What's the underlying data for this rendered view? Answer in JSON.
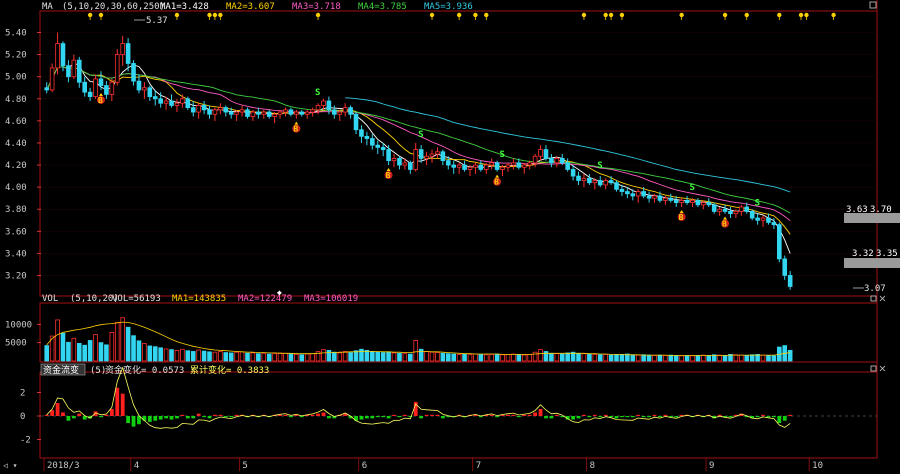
{
  "colors": {
    "bg": "#000000",
    "frame": "#a01010",
    "up": "#ff3030",
    "down": "#33d6f0",
    "ma1": "#ffffff",
    "ma2": "#ffd200",
    "ma3": "#ff5cc6",
    "ma4": "#40d040",
    "ma5": "#30c8e0",
    "tick": "#ff4040",
    "label": "#c8c8c8",
    "pos_bar": "#ff2020",
    "neg_bar": "#10d010",
    "cum_line": "#ffff60",
    "event": "#ffd000",
    "buy": "#ffd000",
    "sell": "#40ff40"
  },
  "main": {
    "legend": {
      "name": "MA",
      "params": "(5,10,20,30,60,250)",
      "ma1": "MA1=3.428",
      "ma2": "MA2=3.607",
      "ma3": "MA3=3.718",
      "ma4": "MA4=3.785",
      "ma5": "MA5=3.936"
    },
    "annotations": {
      "high": "5.37",
      "low": "3.07",
      "right_top_a": "3.63",
      "right_top_b": "3.70",
      "right_bot_a": "3.32",
      "right_bot_b": "3.35"
    },
    "markers": [
      "B",
      "S"
    ]
  },
  "vol": {
    "legend": {
      "name": "VOL",
      "params": "(5,10,20)",
      "vol": "VOL=56193",
      "ma1": "MA1=143835",
      "ma2": "MA2=122479",
      "ma3": "MA3=106019"
    }
  },
  "ind": {
    "legend": {
      "name": "资金流变",
      "params": "(5)",
      "a": "资金变化= 0.0573",
      "b": "累计变化= 0.3833"
    }
  },
  "x_axis": {
    "labels": [
      {
        "text": "2018/3",
        "day": 0
      },
      {
        "text": "4",
        "day": 16
      },
      {
        "text": "5",
        "day": 36
      },
      {
        "text": "6",
        "day": 58
      },
      {
        "text": "7",
        "day": 79
      },
      {
        "text": "8",
        "day": 100
      },
      {
        "text": "9",
        "day": 122
      },
      {
        "text": "10",
        "day": 141
      }
    ]
  },
  "chart_data": {
    "type": "candlestick",
    "y_ticks": [
      "5.40",
      "5.20",
      "5.00",
      "4.80",
      "4.60",
      "4.40",
      "4.20",
      "4.00",
      "3.80",
      "3.60",
      "3.40",
      "3.20"
    ],
    "ylim": [
      3.05,
      5.55
    ],
    "vol_ticks": [
      "10000",
      "5000"
    ],
    "vol_max": 15000,
    "ind_ticks": [
      "2",
      "0",
      "-2"
    ],
    "ind_lim": [
      -3.4,
      3.4
    ],
    "days": 150,
    "candles": [
      [
        4.9,
        4.95,
        4.85,
        4.88
      ],
      [
        4.88,
        5.12,
        4.86,
        5.08
      ],
      [
        5.08,
        5.4,
        5.02,
        5.3
      ],
      [
        5.3,
        5.32,
        5.05,
        5.1
      ],
      [
        5.1,
        5.15,
        4.95,
        5.0
      ],
      [
        5.0,
        5.2,
        4.98,
        5.15
      ],
      [
        5.15,
        5.18,
        4.9,
        4.95
      ],
      [
        4.95,
        5.0,
        4.82,
        4.86
      ],
      [
        4.86,
        4.9,
        4.78,
        4.82
      ],
      [
        4.82,
        5.02,
        4.8,
        4.98
      ],
      [
        4.98,
        5.05,
        4.88,
        4.92
      ],
      [
        4.92,
        4.96,
        4.8,
        4.84
      ],
      [
        4.84,
        4.98,
        4.78,
        4.95
      ],
      [
        4.95,
        5.25,
        4.92,
        5.2
      ],
      [
        5.2,
        5.37,
        5.1,
        5.3
      ],
      [
        5.3,
        5.35,
        5.05,
        5.12
      ],
      [
        5.12,
        5.15,
        4.92,
        4.96
      ],
      [
        4.96,
        5.02,
        4.85,
        4.88
      ],
      [
        4.88,
        4.95,
        4.8,
        4.9
      ],
      [
        4.9,
        4.92,
        4.78,
        4.82
      ],
      [
        4.82,
        4.88,
        4.74,
        4.8
      ],
      [
        4.8,
        4.86,
        4.72,
        4.76
      ],
      [
        4.76,
        4.82,
        4.7,
        4.78
      ],
      [
        4.78,
        4.84,
        4.72,
        4.74
      ],
      [
        4.74,
        4.8,
        4.68,
        4.76
      ],
      [
        4.76,
        4.84,
        4.72,
        4.8
      ],
      [
        4.8,
        4.82,
        4.7,
        4.72
      ],
      [
        4.72,
        4.78,
        4.64,
        4.68
      ],
      [
        4.68,
        4.76,
        4.62,
        4.74
      ],
      [
        4.74,
        4.78,
        4.66,
        4.7
      ],
      [
        4.7,
        4.74,
        4.62,
        4.66
      ],
      [
        4.66,
        4.72,
        4.6,
        4.7
      ],
      [
        4.7,
        4.76,
        4.66,
        4.72
      ],
      [
        4.72,
        4.74,
        4.64,
        4.68
      ],
      [
        4.68,
        4.72,
        4.62,
        4.66
      ],
      [
        4.66,
        4.7,
        4.6,
        4.68
      ],
      [
        4.68,
        4.74,
        4.64,
        4.7
      ],
      [
        4.7,
        4.72,
        4.62,
        4.64
      ],
      [
        4.64,
        4.7,
        4.6,
        4.68
      ],
      [
        4.68,
        4.72,
        4.62,
        4.66
      ],
      [
        4.66,
        4.7,
        4.62,
        4.68
      ],
      [
        4.68,
        4.7,
        4.62,
        4.64
      ],
      [
        4.64,
        4.68,
        4.58,
        4.66
      ],
      [
        4.66,
        4.7,
        4.62,
        4.68
      ],
      [
        4.68,
        4.72,
        4.64,
        4.7
      ],
      [
        4.7,
        4.72,
        4.64,
        4.66
      ],
      [
        4.66,
        4.7,
        4.62,
        4.68
      ],
      [
        4.68,
        4.7,
        4.64,
        4.66
      ],
      [
        4.66,
        4.7,
        4.62,
        4.68
      ],
      [
        4.68,
        4.72,
        4.64,
        4.7
      ],
      [
        4.7,
        4.76,
        4.66,
        4.74
      ],
      [
        4.74,
        4.8,
        4.7,
        4.78
      ],
      [
        4.78,
        4.82,
        4.66,
        4.7
      ],
      [
        4.7,
        4.74,
        4.62,
        4.66
      ],
      [
        4.66,
        4.7,
        4.6,
        4.68
      ],
      [
        4.68,
        4.76,
        4.64,
        4.72
      ],
      [
        4.72,
        4.74,
        4.62,
        4.66
      ],
      [
        4.66,
        4.68,
        4.48,
        4.52
      ],
      [
        4.52,
        4.56,
        4.4,
        4.46
      ],
      [
        4.46,
        4.5,
        4.38,
        4.44
      ],
      [
        4.44,
        4.48,
        4.34,
        4.38
      ],
      [
        4.38,
        4.42,
        4.3,
        4.36
      ],
      [
        4.36,
        4.4,
        4.28,
        4.34
      ],
      [
        4.34,
        4.38,
        4.2,
        4.24
      ],
      [
        4.24,
        4.3,
        4.18,
        4.26
      ],
      [
        4.26,
        4.28,
        4.16,
        4.2
      ],
      [
        4.2,
        4.26,
        4.16,
        4.22
      ],
      [
        4.22,
        4.24,
        4.12,
        4.16
      ],
      [
        4.16,
        4.4,
        4.14,
        4.34
      ],
      [
        4.34,
        4.38,
        4.22,
        4.26
      ],
      [
        4.26,
        4.32,
        4.2,
        4.28
      ],
      [
        4.28,
        4.34,
        4.22,
        4.3
      ],
      [
        4.3,
        4.36,
        4.26,
        4.32
      ],
      [
        4.32,
        4.34,
        4.2,
        4.24
      ],
      [
        4.24,
        4.28,
        4.16,
        4.2
      ],
      [
        4.2,
        4.24,
        4.12,
        4.18
      ],
      [
        4.18,
        4.22,
        4.12,
        4.2
      ],
      [
        4.2,
        4.24,
        4.14,
        4.16
      ],
      [
        4.16,
        4.2,
        4.1,
        4.18
      ],
      [
        4.18,
        4.22,
        4.12,
        4.2
      ],
      [
        4.2,
        4.24,
        4.14,
        4.16
      ],
      [
        4.16,
        4.22,
        4.12,
        4.2
      ],
      [
        4.2,
        4.26,
        4.16,
        4.22
      ],
      [
        4.22,
        4.24,
        4.14,
        4.16
      ],
      [
        4.16,
        4.2,
        4.1,
        4.18
      ],
      [
        4.18,
        4.22,
        4.14,
        4.2
      ],
      [
        4.2,
        4.26,
        4.16,
        4.22
      ],
      [
        4.22,
        4.26,
        4.16,
        4.18
      ],
      [
        4.18,
        4.22,
        4.12,
        4.2
      ],
      [
        4.2,
        4.24,
        4.16,
        4.22
      ],
      [
        4.22,
        4.3,
        4.18,
        4.28
      ],
      [
        4.28,
        4.38,
        4.24,
        4.34
      ],
      [
        4.34,
        4.38,
        4.24,
        4.26
      ],
      [
        4.26,
        4.3,
        4.18,
        4.22
      ],
      [
        4.22,
        4.28,
        4.18,
        4.26
      ],
      [
        4.26,
        4.3,
        4.2,
        4.22
      ],
      [
        4.22,
        4.26,
        4.14,
        4.16
      ],
      [
        4.16,
        4.2,
        4.06,
        4.1
      ],
      [
        4.1,
        4.14,
        4.02,
        4.06
      ],
      [
        4.06,
        4.12,
        4.0,
        4.08
      ],
      [
        4.08,
        4.12,
        4.02,
        4.04
      ],
      [
        4.04,
        4.08,
        3.98,
        4.06
      ],
      [
        4.06,
        4.1,
        4.0,
        4.02
      ],
      [
        4.02,
        4.08,
        3.98,
        4.06
      ],
      [
        4.06,
        4.1,
        4.02,
        4.04
      ],
      [
        4.04,
        4.06,
        3.96,
        3.98
      ],
      [
        3.98,
        4.02,
        3.92,
        3.96
      ],
      [
        3.96,
        4.0,
        3.9,
        3.94
      ],
      [
        3.94,
        3.98,
        3.88,
        3.92
      ],
      [
        3.92,
        3.98,
        3.86,
        3.96
      ],
      [
        3.96,
        4.0,
        3.9,
        3.92
      ],
      [
        3.92,
        3.96,
        3.86,
        3.9
      ],
      [
        3.9,
        3.94,
        3.86,
        3.92
      ],
      [
        3.92,
        3.96,
        3.86,
        3.88
      ],
      [
        3.88,
        3.92,
        3.84,
        3.9
      ],
      [
        3.9,
        3.94,
        3.86,
        3.88
      ],
      [
        3.88,
        3.92,
        3.82,
        3.86
      ],
      [
        3.86,
        3.9,
        3.82,
        3.88
      ],
      [
        3.88,
        3.92,
        3.84,
        3.86
      ],
      [
        3.86,
        3.9,
        3.82,
        3.88
      ],
      [
        3.88,
        3.9,
        3.82,
        3.84
      ],
      [
        3.84,
        3.88,
        3.8,
        3.86
      ],
      [
        3.86,
        3.9,
        3.82,
        3.84
      ],
      [
        3.84,
        3.86,
        3.76,
        3.78
      ],
      [
        3.78,
        3.82,
        3.74,
        3.8
      ],
      [
        3.8,
        3.84,
        3.76,
        3.78
      ],
      [
        3.78,
        3.82,
        3.72,
        3.76
      ],
      [
        3.76,
        3.8,
        3.72,
        3.78
      ],
      [
        3.78,
        3.84,
        3.74,
        3.82
      ],
      [
        3.82,
        3.86,
        3.76,
        3.78
      ],
      [
        3.78,
        3.8,
        3.7,
        3.72
      ],
      [
        3.72,
        3.76,
        3.66,
        3.7
      ],
      [
        3.7,
        3.74,
        3.64,
        3.72
      ],
      [
        3.72,
        3.76,
        3.66,
        3.68
      ],
      [
        3.68,
        3.72,
        3.62,
        3.66
      ],
      [
        3.66,
        3.68,
        3.32,
        3.35
      ],
      [
        3.35,
        3.38,
        3.16,
        3.2
      ],
      [
        3.2,
        3.24,
        3.07,
        3.1
      ]
    ],
    "volumes": [
      4200,
      6800,
      11200,
      7600,
      5100,
      6200,
      4800,
      4300,
      5600,
      7200,
      5000,
      4400,
      7800,
      10500,
      11800,
      9200,
      6900,
      5500,
      4800,
      4100,
      3900,
      3600,
      3300,
      3100,
      2900,
      3200,
      2800,
      2600,
      3000,
      2700,
      2500,
      2400,
      2600,
      2300,
      2200,
      2400,
      2500,
      2100,
      2200,
      2000,
      2100,
      1900,
      2000,
      2200,
      2100,
      1900,
      1800,
      1700,
      1900,
      2000,
      2600,
      3100,
      2900,
      2400,
      2200,
      2600,
      2300,
      2800,
      3200,
      2900,
      2600,
      2400,
      2300,
      2500,
      2200,
      2100,
      2000,
      1900,
      5600,
      3200,
      2600,
      2400,
      2300,
      2100,
      2000,
      1900,
      1800,
      1800,
      1700,
      1900,
      1800,
      1700,
      1800,
      1900,
      1700,
      1800,
      1900,
      1700,
      1600,
      1800,
      2400,
      3100,
      2600,
      2100,
      2000,
      1900,
      2200,
      2400,
      2100,
      2000,
      1900,
      1800,
      1700,
      1800,
      1600,
      1700,
      1800,
      1900,
      1700,
      1600,
      1700,
      1600,
      1500,
      1600,
      1500,
      1600,
      1500,
      1400,
      1500,
      1400,
      1500,
      1600,
      1500,
      1700,
      1600,
      1500,
      1800,
      1700,
      1600,
      1500,
      1700,
      1800,
      1600,
      1500,
      1400,
      3800,
      4200,
      2900
    ],
    "vol_ma": [
      4400,
      6100,
      7200,
      7800,
      8100,
      8400,
      8600,
      8900,
      9200,
      9600,
      9900,
      10100,
      10200,
      10400,
      10600,
      10500,
      10200,
      9700,
      9200,
      8600,
      8000,
      7300,
      6600,
      5900,
      5300,
      4800,
      4400,
      4000,
      3700,
      3400,
      3200,
      3000,
      2900,
      2800,
      2700,
      2600,
      2500,
      2400,
      2400,
      2300,
      2300,
      2200,
      2200,
      2100,
      2100,
      2100,
      2000,
      2000,
      2000,
      2000,
      2100,
      2200,
      2300,
      2300,
      2400,
      2400,
      2500,
      2500,
      2600,
      2600,
      2600,
      2600,
      2500,
      2500,
      2400,
      2400,
      2300,
      2300,
      2500,
      2600,
      2600,
      2500,
      2500,
      2400,
      2300,
      2200,
      2100,
      2000,
      2000,
      1900,
      1900,
      1900,
      1900,
      1900,
      1800,
      1800,
      1800,
      1800,
      1800,
      1800,
      1900,
      2000,
      2100,
      2100,
      2100,
      2100,
      2100,
      2100,
      2100,
      2100,
      2000,
      2000,
      1900,
      1900,
      1800,
      1800,
      1800,
      1700,
      1700,
      1700,
      1600,
      1600,
      1600,
      1600,
      1600,
      1500,
      1500,
      1500,
      1500,
      1500,
      1500,
      1500,
      1500,
      1500,
      1500,
      1500,
      1600,
      1600,
      1600,
      1600,
      1600,
      1600,
      1600,
      1600,
      1600,
      1800,
      2100,
      2300
    ],
    "ind_bars": [
      0.1,
      0.5,
      1.1,
      0.3,
      -0.4,
      -0.2,
      0.2,
      -0.3,
      -0.2,
      0.4,
      -0.1,
      0.1,
      0.6,
      2.4,
      1.9,
      -0.6,
      -0.9,
      -0.7,
      -0.4,
      -0.5,
      -0.4,
      -0.3,
      -0.2,
      -0.3,
      -0.2,
      0.1,
      -0.2,
      -0.2,
      0.2,
      -0.1,
      -0.2,
      0.1,
      0.1,
      -0.1,
      -0.1,
      0.1,
      0.1,
      -0.1,
      0.1,
      -0.1,
      0.1,
      -0.1,
      0.1,
      0.1,
      0.1,
      -0.1,
      0.1,
      -0.1,
      0.1,
      0.1,
      0.2,
      0.3,
      -0.2,
      -0.2,
      0.1,
      0.2,
      -0.2,
      -0.4,
      -0.3,
      -0.2,
      -0.2,
      -0.1,
      -0.1,
      -0.2,
      0.1,
      -0.1,
      0.1,
      -0.1,
      1.2,
      -0.2,
      0.1,
      0.1,
      0.1,
      -0.2,
      -0.1,
      -0.1,
      0.1,
      -0.1,
      0.1,
      0.1,
      -0.1,
      0.1,
      0.1,
      -0.1,
      0.1,
      0.1,
      0.1,
      -0.1,
      0.1,
      0.1,
      0.3,
      0.6,
      -0.2,
      -0.2,
      0.1,
      -0.1,
      -0.3,
      -0.3,
      -0.2,
      0.1,
      -0.1,
      0.1,
      -0.1,
      0.1,
      -0.1,
      -0.2,
      -0.1,
      -0.1,
      -0.1,
      0.1,
      -0.1,
      -0.1,
      0.1,
      -0.1,
      0.1,
      -0.1,
      -0.1,
      0.1,
      0.1,
      -0.1,
      0.1,
      -0.1,
      0.1,
      -0.2,
      0.1,
      -0.1,
      -0.1,
      0.1,
      0.2,
      -0.1,
      -0.2,
      -0.1,
      0.1,
      -0.1,
      -0.1,
      -0.6,
      -0.4,
      0.1
    ],
    "buy_days": [
      10,
      46,
      63,
      83,
      117,
      125
    ],
    "sell_days": [
      50,
      69,
      84,
      102,
      119,
      131
    ],
    "event_days": [
      8,
      10,
      24,
      30,
      31,
      32,
      50,
      71,
      76,
      79,
      81,
      99,
      103,
      104,
      106,
      117,
      125,
      129,
      135,
      139,
      140,
      145
    ]
  }
}
